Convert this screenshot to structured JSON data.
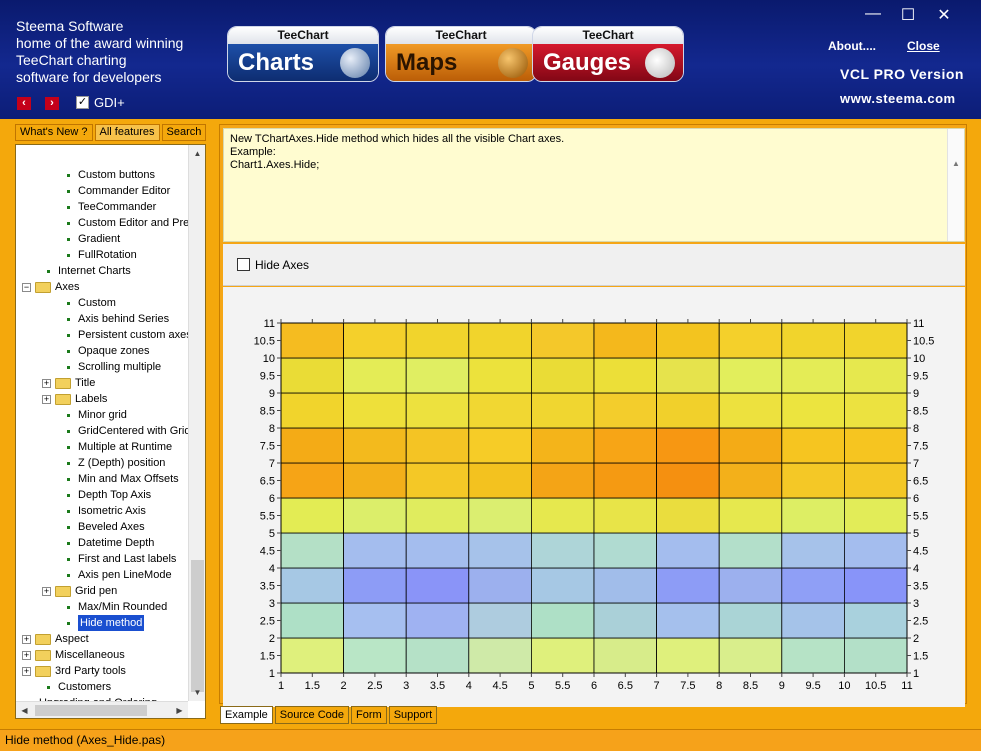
{
  "header": {
    "brand_lines": [
      "Steema Software",
      "home of the award winning",
      "TeeChart charting",
      "software for developers"
    ],
    "nav_prev_icon": "arrow-left-icon",
    "nav_next_icon": "arrow-right-icon",
    "gdi_label": "GDI+",
    "gdi_checked": true,
    "logos": [
      {
        "top": "TeeChart",
        "bottom": "Charts"
      },
      {
        "top": "TeeChart",
        "bottom": "Maps"
      },
      {
        "top": "TeeChart",
        "bottom": "Gauges"
      }
    ],
    "about_label": "About....",
    "close_label": "Close",
    "version": "VCL PRO Version",
    "website": "www.steema.com",
    "window_buttons": [
      "minimize-icon",
      "maximize-icon",
      "close-icon"
    ]
  },
  "left_tabs": [
    {
      "label": "What's New ?",
      "active": false
    },
    {
      "label": "All features",
      "active": true
    },
    {
      "label": "Search",
      "active": false
    }
  ],
  "tree": [
    {
      "label": "Custom buttons",
      "indent": 2,
      "kind": "leaf"
    },
    {
      "label": "Commander Editor",
      "indent": 2,
      "kind": "leaf"
    },
    {
      "label": "TeeCommander",
      "indent": 2,
      "kind": "leaf"
    },
    {
      "label": "Custom Editor and Pre",
      "indent": 2,
      "kind": "leaf"
    },
    {
      "label": "Gradient",
      "indent": 2,
      "kind": "leaf"
    },
    {
      "label": "FullRotation",
      "indent": 2,
      "kind": "leaf"
    },
    {
      "label": "Internet Charts",
      "indent": 1,
      "kind": "leaf"
    },
    {
      "label": "Axes",
      "indent": 0,
      "kind": "folder-open"
    },
    {
      "label": "Custom",
      "indent": 2,
      "kind": "leaf"
    },
    {
      "label": "Axis behind Series",
      "indent": 2,
      "kind": "leaf"
    },
    {
      "label": "Persistent custom axes",
      "indent": 2,
      "kind": "leaf"
    },
    {
      "label": "Opaque zones",
      "indent": 2,
      "kind": "leaf"
    },
    {
      "label": "Scrolling multiple",
      "indent": 2,
      "kind": "leaf"
    },
    {
      "label": "Title",
      "indent": 1,
      "kind": "folder"
    },
    {
      "label": "Labels",
      "indent": 1,
      "kind": "folder"
    },
    {
      "label": "Minor grid",
      "indent": 2,
      "kind": "leaf"
    },
    {
      "label": "GridCentered with Grid",
      "indent": 2,
      "kind": "leaf"
    },
    {
      "label": "Multiple at Runtime",
      "indent": 2,
      "kind": "leaf"
    },
    {
      "label": "Z (Depth) position",
      "indent": 2,
      "kind": "leaf"
    },
    {
      "label": "Min and Max Offsets",
      "indent": 2,
      "kind": "leaf"
    },
    {
      "label": "Depth Top Axis",
      "indent": 2,
      "kind": "leaf"
    },
    {
      "label": "Isometric Axis",
      "indent": 2,
      "kind": "leaf"
    },
    {
      "label": "Beveled Axes",
      "indent": 2,
      "kind": "leaf"
    },
    {
      "label": "Datetime Depth",
      "indent": 2,
      "kind": "leaf"
    },
    {
      "label": "First and Last labels",
      "indent": 2,
      "kind": "leaf"
    },
    {
      "label": "Axis pen LineMode",
      "indent": 2,
      "kind": "leaf"
    },
    {
      "label": "Grid pen",
      "indent": 1,
      "kind": "folder"
    },
    {
      "label": "Max/Min Rounded",
      "indent": 2,
      "kind": "leaf"
    },
    {
      "label": "Hide method",
      "indent": 2,
      "kind": "leaf",
      "selected": true
    },
    {
      "label": "Aspect",
      "indent": 0,
      "kind": "folder"
    },
    {
      "label": "Miscellaneous",
      "indent": 0,
      "kind": "folder"
    },
    {
      "label": "3rd Party tools",
      "indent": 0,
      "kind": "folder"
    },
    {
      "label": "Customers",
      "indent": 0,
      "kind": "leaf-top"
    },
    {
      "label": "Upgrading and Ordering",
      "indent": -1,
      "kind": "leaf"
    }
  ],
  "description": {
    "line1": "New TChartAxes.Hide method which hides all the visible Chart axes.",
    "line2": "",
    "line3": "Example:",
    "line4": "Chart1.Axes.Hide;"
  },
  "hide_axes_label": "Hide Axes",
  "hide_axes_checked": false,
  "bottom_tabs": [
    {
      "label": "Example",
      "active": true
    },
    {
      "label": "Source Code",
      "active": false
    },
    {
      "label": "Form",
      "active": false
    },
    {
      "label": "Support",
      "active": false
    }
  ],
  "status_text": "Hide method (Axes_Hide.pas)",
  "chart_data": {
    "type": "heatmap",
    "xlim": [
      1,
      11
    ],
    "ylim": [
      1,
      11
    ],
    "x_tick_labels": [
      "1",
      "1.5",
      "2",
      "2.5",
      "3",
      "3.5",
      "4",
      "4.5",
      "5",
      "5.5",
      "6",
      "6.5",
      "7",
      "7.5",
      "8",
      "8.5",
      "9",
      "9.5",
      "10",
      "10.5",
      "11"
    ],
    "y_tick_labels": [
      "1",
      "1.5",
      "2",
      "2.5",
      "3",
      "3.5",
      "4",
      "4.5",
      "5",
      "5.5",
      "6",
      "6.5",
      "7",
      "7.5",
      "8",
      "8.5",
      "9",
      "9.5",
      "10",
      "10.5",
      "11"
    ],
    "right_axis_labels": [
      "1",
      "1.5",
      "2",
      "2.5",
      "3",
      "3.5",
      "4",
      "4.5",
      "5",
      "5.5",
      "6",
      "6.5",
      "7",
      "7.5",
      "8",
      "8.5",
      "9",
      "9.5",
      "10",
      "10.5",
      "11"
    ],
    "grid": true,
    "rows": 10,
    "cols": 10,
    "cell_colors": [
      [
        "#dff07c",
        "#b9e6c6",
        "#b5e1c7",
        "#cfeaa8",
        "#dff07c",
        "#d7ec8a",
        "#dff07c",
        "#d9ee8c",
        "#b6e3c6",
        "#b3e0c8"
      ],
      [
        "#aee0c6",
        "#a6bff0",
        "#9fb2f2",
        "#aeccdf",
        "#aee0c6",
        "#aad0d8",
        "#a5c0ed",
        "#aad4d6",
        "#a5c3e9",
        "#a9d1dd"
      ],
      [
        "#a6c8e4",
        "#8d9cf6",
        "#8a94f8",
        "#9cb0ee",
        "#a6c8e4",
        "#a1bdea",
        "#8d9cf6",
        "#9cb0ee",
        "#8f9ff6",
        "#8894f9"
      ],
      [
        "#b4e0c6",
        "#a4bdee",
        "#a4bdee",
        "#a6c2ea",
        "#aed5d8",
        "#b0dbd1",
        "#a4bdee",
        "#b3dfca",
        "#a6c2ea",
        "#a4bdee"
      ],
      [
        "#e3ec54",
        "#dcee6a",
        "#e0ec5e",
        "#dbee70",
        "#e6e84e",
        "#e8e448",
        "#eadd3e",
        "#e6e84e",
        "#ddee64",
        "#e2ec58"
      ],
      [
        "#f6a416",
        "#f3b01a",
        "#f4c826",
        "#f3c21f",
        "#f4a416",
        "#f59a12",
        "#f59010",
        "#f3b01a",
        "#f4c826",
        "#f4c826"
      ],
      [
        "#f4ab16",
        "#f3ba1d",
        "#f4c424",
        "#f6cc27",
        "#f4b41a",
        "#f7a516",
        "#f79712",
        "#f4ab16",
        "#f6c520",
        "#f6c520"
      ],
      [
        "#f1d42c",
        "#eee03a",
        "#ede13e",
        "#f1d732",
        "#f0d630",
        "#f3cd2c",
        "#f1d02b",
        "#ede13e",
        "#ece43f",
        "#ece240"
      ],
      [
        "#eadc36",
        "#e4ec56",
        "#e0ee62",
        "#ece23c",
        "#eadc36",
        "#ecdf38",
        "#e6e34c",
        "#e2ee5c",
        "#e4ec56",
        "#e6e84e"
      ],
      [
        "#f5bc20",
        "#f4d02b",
        "#f1d42c",
        "#f1d42c",
        "#f4c82a",
        "#f4b81c",
        "#f3c41f",
        "#f4d02b",
        "#f1d42c",
        "#f1d42c"
      ]
    ]
  }
}
